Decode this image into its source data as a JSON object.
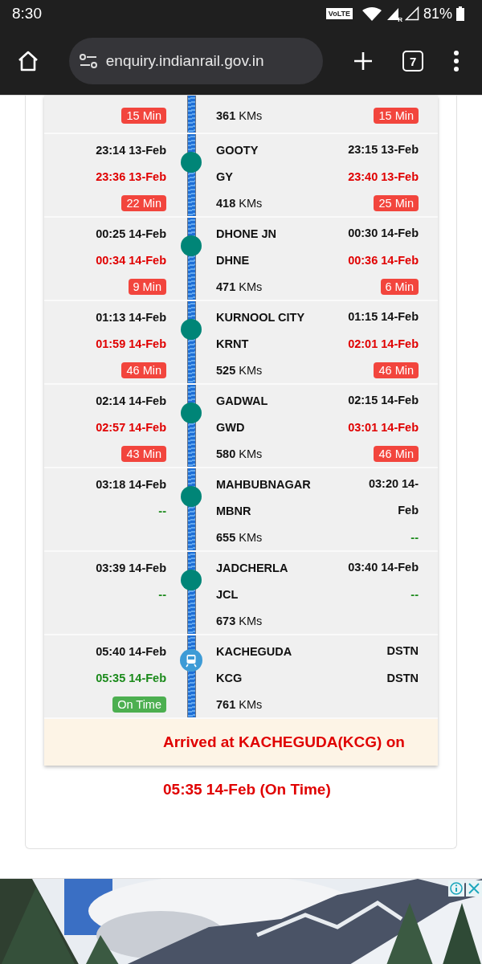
{
  "status_bar": {
    "time": "8:30",
    "volte": "VoLTE",
    "roaming": "R",
    "battery": "81%"
  },
  "browser": {
    "url": "enquiry.indianrail.gov.in",
    "tab_count": "7"
  },
  "stops": [
    {
      "arr_delay": {
        "text": "15 Min",
        "kind": "late"
      },
      "km": "**361** KMs",
      "dep_delay": {
        "text": "15 Min",
        "kind": "late"
      }
    },
    {
      "kind": "stop",
      "arr_sched": "23:14 13-Feb",
      "arr_actual": {
        "text": "23:36 13-Feb",
        "kind": "late"
      },
      "arr_delay": {
        "text": "22 Min",
        "kind": "late"
      },
      "station": "GOOTY",
      "code": "GY",
      "km": "**418** KMs",
      "dep_sched": {
        "text": "23:15 13-Feb",
        "wrapped": false
      },
      "dep_actual": {
        "text": "23:40 13-Feb",
        "kind": "late"
      },
      "dep_delay": {
        "text": "25 Min",
        "kind": "late"
      }
    },
    {
      "kind": "stop",
      "arr_sched": "00:25 14-Feb",
      "arr_actual": {
        "text": "00:34 14-Feb",
        "kind": "late"
      },
      "arr_delay": {
        "text": "9 Min",
        "kind": "late"
      },
      "station": "DHONE JN",
      "code": "DHNE",
      "km": "**471** KMs",
      "dep_sched": {
        "text": "00:30 14-Feb",
        "wrapped": false
      },
      "dep_actual": {
        "text": "00:36 14-Feb",
        "kind": "late"
      },
      "dep_delay": {
        "text": "6 Min",
        "kind": "late"
      }
    },
    {
      "kind": "stop",
      "arr_sched": "01:13 14-Feb",
      "arr_actual": {
        "text": "01:59 14-Feb",
        "kind": "late"
      },
      "arr_delay": {
        "text": "46 Min",
        "kind": "late"
      },
      "station": "KURNOOL CITY",
      "code": "KRNT",
      "km": "**525** KMs",
      "dep_sched": {
        "text": "01:15 14-Feb",
        "wrapped": false
      },
      "dep_actual": {
        "text": "02:01 14-Feb",
        "kind": "late"
      },
      "dep_delay": {
        "text": "46 Min",
        "kind": "late"
      }
    },
    {
      "kind": "stop",
      "arr_sched": "02:14 14-Feb",
      "arr_actual": {
        "text": "02:57 14-Feb",
        "kind": "late"
      },
      "arr_delay": {
        "text": "43 Min",
        "kind": "late"
      },
      "station": "GADWAL",
      "code": "GWD",
      "km": "**580** KMs",
      "dep_sched": {
        "text": "02:15 14-Feb",
        "wrapped": false
      },
      "dep_actual": {
        "text": "03:01 14-Feb",
        "kind": "late"
      },
      "dep_delay": {
        "text": "46 Min",
        "kind": "late"
      }
    },
    {
      "kind": "stop",
      "arr_sched": "03:18 14-Feb",
      "arr_actual": {
        "text": "--",
        "kind": "on_time"
      },
      "station": "MAHBUBNAGAR",
      "code": "MBNR",
      "km": "**655** KMs",
      "dep_sched": {
        "text": "03:20 14-Feb",
        "wrapped": true
      },
      "dep_actual": {
        "text": "--",
        "kind": "on_time"
      }
    },
    {
      "kind": "stop",
      "arr_sched": "03:39 14-Feb",
      "arr_actual": {
        "text": "--",
        "kind": "on_time"
      },
      "station": "JADCHERLA",
      "code": "JCL",
      "km": "**673** KMs",
      "dep_sched": {
        "text": "03:40 14-Feb",
        "wrapped": false
      },
      "dep_actual": {
        "text": "--",
        "kind": "on_time"
      }
    },
    {
      "kind": "current",
      "arr_sched": "05:40 14-Feb",
      "arr_actual": {
        "text": "05:35 14-Feb",
        "kind": "on_time"
      },
      "arr_delay": {
        "text": "On Time",
        "kind": "on_time"
      },
      "station": "KACHEGUDA",
      "code": "KCG",
      "km": "**761** KMs",
      "dep_sched": {
        "text": "DSTN",
        "wrapped": false
      },
      "dep_actual": {
        "text": "DSTN",
        "kind": "plain"
      }
    }
  ],
  "arrival_message": [
    "Arrived at KACHEGUDA(KCG) on",
    "05:35 14-Feb (On Time)"
  ]
}
